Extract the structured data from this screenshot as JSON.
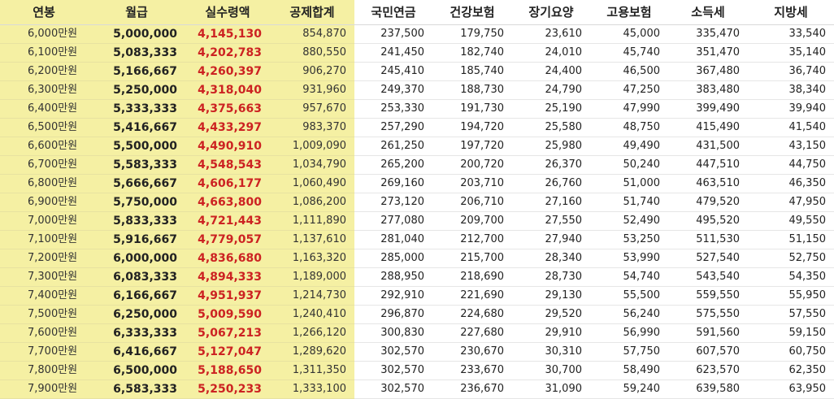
{
  "headers": [
    "연봉",
    "월급",
    "실수령액",
    "공제합계",
    "국민연금",
    "건강보험",
    "장기요양",
    "고용보험",
    "소득세",
    "지방세"
  ],
  "rows": [
    [
      "6,000만원",
      "5,000,000",
      "4,145,130",
      "854,870",
      "237,500",
      "179,750",
      "23,610",
      "45,000",
      "335,470",
      "33,540"
    ],
    [
      "6,100만원",
      "5,083,333",
      "4,202,783",
      "880,550",
      "241,450",
      "182,740",
      "24,010",
      "45,740",
      "351,470",
      "35,140"
    ],
    [
      "6,200만원",
      "5,166,667",
      "4,260,397",
      "906,270",
      "245,410",
      "185,740",
      "24,400",
      "46,500",
      "367,480",
      "36,740"
    ],
    [
      "6,300만원",
      "5,250,000",
      "4,318,040",
      "931,960",
      "249,370",
      "188,730",
      "24,790",
      "47,250",
      "383,480",
      "38,340"
    ],
    [
      "6,400만원",
      "5,333,333",
      "4,375,663",
      "957,670",
      "253,330",
      "191,730",
      "25,190",
      "47,990",
      "399,490",
      "39,940"
    ],
    [
      "6,500만원",
      "5,416,667",
      "4,433,297",
      "983,370",
      "257,290",
      "194,720",
      "25,580",
      "48,750",
      "415,490",
      "41,540"
    ],
    [
      "6,600만원",
      "5,500,000",
      "4,490,910",
      "1,009,090",
      "261,250",
      "197,720",
      "25,980",
      "49,490",
      "431,500",
      "43,150"
    ],
    [
      "6,700만원",
      "5,583,333",
      "4,548,543",
      "1,034,790",
      "265,200",
      "200,720",
      "26,370",
      "50,240",
      "447,510",
      "44,750"
    ],
    [
      "6,800만원",
      "5,666,667",
      "4,606,177",
      "1,060,490",
      "269,160",
      "203,710",
      "26,760",
      "51,000",
      "463,510",
      "46,350"
    ],
    [
      "6,900만원",
      "5,750,000",
      "4,663,800",
      "1,086,200",
      "273,120",
      "206,710",
      "27,160",
      "51,740",
      "479,520",
      "47,950"
    ],
    [
      "7,000만원",
      "5,833,333",
      "4,721,443",
      "1,111,890",
      "277,080",
      "209,700",
      "27,550",
      "52,490",
      "495,520",
      "49,550"
    ],
    [
      "7,100만원",
      "5,916,667",
      "4,779,057",
      "1,137,610",
      "281,040",
      "212,700",
      "27,940",
      "53,250",
      "511,530",
      "51,150"
    ],
    [
      "7,200만원",
      "6,000,000",
      "4,836,680",
      "1,163,320",
      "285,000",
      "215,700",
      "28,340",
      "53,990",
      "527,540",
      "52,750"
    ],
    [
      "7,300만원",
      "6,083,333",
      "4,894,333",
      "1,189,000",
      "288,950",
      "218,690",
      "28,730",
      "54,740",
      "543,540",
      "54,350"
    ],
    [
      "7,400만원",
      "6,166,667",
      "4,951,937",
      "1,214,730",
      "292,910",
      "221,690",
      "29,130",
      "55,500",
      "559,550",
      "55,950"
    ],
    [
      "7,500만원",
      "6,250,000",
      "5,009,590",
      "1,240,410",
      "296,870",
      "224,680",
      "29,520",
      "56,240",
      "575,550",
      "57,550"
    ],
    [
      "7,600만원",
      "6,333,333",
      "5,067,213",
      "1,266,120",
      "300,830",
      "227,680",
      "29,910",
      "56,990",
      "591,560",
      "59,150"
    ],
    [
      "7,700만원",
      "6,416,667",
      "5,127,047",
      "1,289,620",
      "302,570",
      "230,670",
      "30,310",
      "57,750",
      "607,570",
      "60,750"
    ],
    [
      "7,800만원",
      "6,500,000",
      "5,188,650",
      "1,311,350",
      "302,570",
      "233,670",
      "30,700",
      "58,490",
      "623,570",
      "62,350"
    ],
    [
      "7,900만원",
      "6,583,333",
      "5,250,233",
      "1,333,100",
      "302,570",
      "236,670",
      "31,090",
      "59,240",
      "639,580",
      "63,950"
    ]
  ],
  "colors": {
    "highlight": "#f5f0a3",
    "net_text": "#cc2222"
  }
}
